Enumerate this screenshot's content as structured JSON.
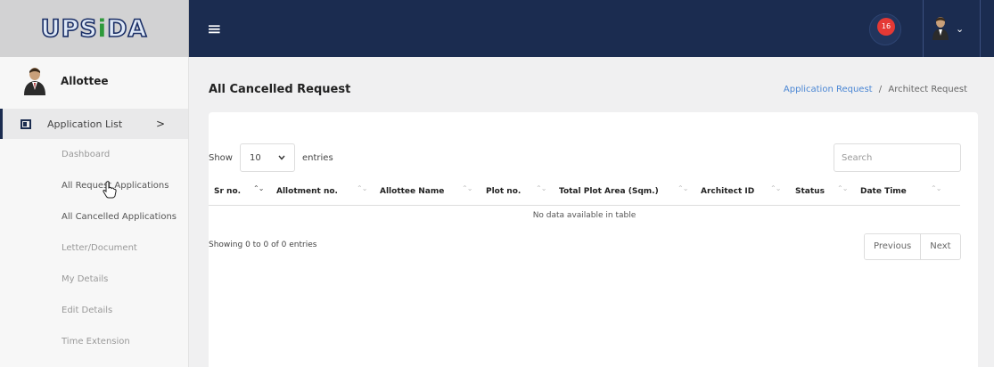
{
  "logo": {
    "text_a": "U",
    "text_b": "PS",
    "dot": "i",
    "text_c": "DA"
  },
  "header": {
    "notifications_count": "16",
    "menu_glyph": "≡",
    "chevron": "⌄"
  },
  "sidebar": {
    "user_name": "Allottee",
    "section": {
      "label": "Application List",
      "arrow": ">"
    },
    "items": [
      {
        "label": "Dashboard"
      },
      {
        "label": "All Request Applications"
      },
      {
        "label": "All Cancelled Applications"
      },
      {
        "label": "Letter/Document"
      },
      {
        "label": "My Details"
      },
      {
        "label": "Edit Details"
      },
      {
        "label": "Time Extension"
      }
    ]
  },
  "page": {
    "title": "All Cancelled Request",
    "breadcrumb": {
      "link": "Application Request",
      "separator": "/",
      "current": "Architect Request"
    }
  },
  "table_controls": {
    "show_label": "Show",
    "entries_value": "10",
    "entries_label": "entries",
    "search_placeholder": "Search"
  },
  "table": {
    "columns": [
      "Sr no.",
      "Allotment no.",
      "Allottee Name",
      "Plot no.",
      "Total Plot Area (Sqm.)",
      "Architect ID",
      "Status",
      "Date Time"
    ],
    "empty_message": "No data available in table",
    "info": "Showing 0 to 0 of 0 entries"
  },
  "pagination": {
    "previous": "Previous",
    "next": "Next"
  },
  "colors": {
    "navbar": "#1b2c50",
    "link": "#4a86d4",
    "badge": "#e53935"
  },
  "icons": [
    "menu-icon",
    "notification-icon",
    "user-avatar-icon",
    "chevron-down-icon",
    "list-icon",
    "chevron-right-icon",
    "sort-icon",
    "hand-cursor-icon"
  ]
}
